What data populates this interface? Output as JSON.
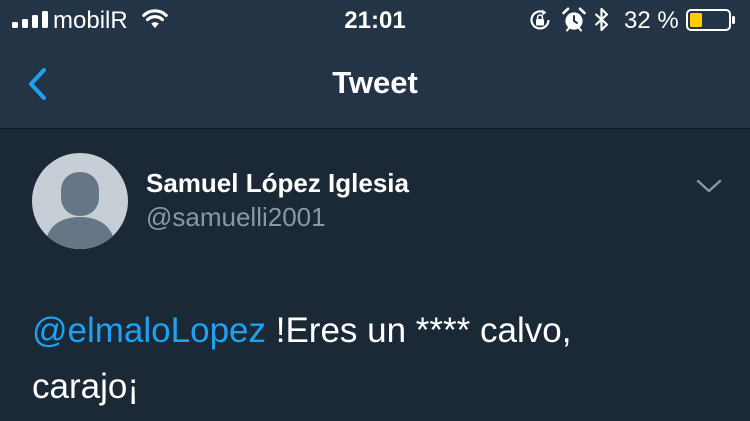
{
  "status_bar": {
    "carrier": "mobilR",
    "time": "21:01",
    "battery_percent": "32 %",
    "battery_level": 0.32,
    "icons": [
      "signal-icon",
      "wifi-icon",
      "rotation-lock-icon",
      "alarm-icon",
      "bluetooth-icon",
      "battery-icon"
    ]
  },
  "nav": {
    "title": "Tweet",
    "back_icon": "chevron-left-icon"
  },
  "tweet": {
    "display_name": "Samuel López Iglesia",
    "handle": "@samuelli2001",
    "mention": "@elmaloLopez",
    "text_line_1_rest": " !Eres un **** calvo,",
    "text_line_2": "carajo¡",
    "menu_icon": "chevron-down-icon"
  },
  "colors": {
    "background": "#1b2836",
    "bars": "#243447",
    "accent": "#1da1f2",
    "secondary_text": "#8899a6",
    "battery_fill": "#ffcc00"
  }
}
